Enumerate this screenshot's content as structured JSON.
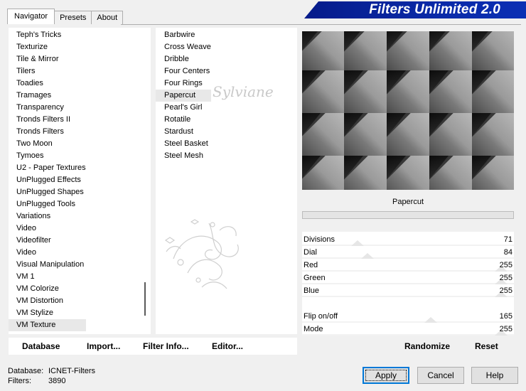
{
  "title": "Filters Unlimited 2.0",
  "tabs": [
    {
      "label": "Navigator",
      "active": true
    },
    {
      "label": "Presets",
      "active": false
    },
    {
      "label": "About",
      "active": false
    }
  ],
  "categories": [
    {
      "label": "Teph's Tricks"
    },
    {
      "label": "Texturize"
    },
    {
      "label": "Tile & Mirror"
    },
    {
      "label": "Tilers"
    },
    {
      "label": "Toadies"
    },
    {
      "label": "Tramages"
    },
    {
      "label": "Transparency"
    },
    {
      "label": "Tronds Filters II"
    },
    {
      "label": "Tronds Filters"
    },
    {
      "label": "Two Moon"
    },
    {
      "label": "Tymoes"
    },
    {
      "label": "U2 - Paper Textures"
    },
    {
      "label": "UnPlugged Effects"
    },
    {
      "label": "UnPlugged Shapes"
    },
    {
      "label": "UnPlugged Tools"
    },
    {
      "label": "Variations"
    },
    {
      "label": "Video"
    },
    {
      "label": "Videofilter"
    },
    {
      "label": "Video"
    },
    {
      "label": "Visual Manipulation"
    },
    {
      "label": "VM 1"
    },
    {
      "label": "VM Colorize"
    },
    {
      "label": "VM Distortion"
    },
    {
      "label": "VM Stylize"
    },
    {
      "label": "VM Texture",
      "selected": true
    }
  ],
  "filters": [
    {
      "label": "Barbwire"
    },
    {
      "label": "Cross Weave"
    },
    {
      "label": "Dribble"
    },
    {
      "label": "Four Centers"
    },
    {
      "label": "Four Rings"
    },
    {
      "label": "Papercut",
      "selected": true
    },
    {
      "label": "Pearl's Girl"
    },
    {
      "label": "Rotatile"
    },
    {
      "label": "Stardust"
    },
    {
      "label": "Steel Basket"
    },
    {
      "label": "Steel Mesh"
    }
  ],
  "watermark": "Sylviane",
  "preview": {
    "rows": 4,
    "cols": 5,
    "colors": {
      "dark": "#1a1a1a",
      "mid": "#7a7a7a",
      "light": "#b8b8b8"
    }
  },
  "current_filter": "Papercut",
  "progress": 0,
  "parameters": [
    {
      "label": "Divisions",
      "value": 71
    },
    {
      "label": "Dial",
      "value": 84
    },
    {
      "label": "Red",
      "value": 255
    },
    {
      "label": "Green",
      "value": 255
    },
    {
      "label": "Blue",
      "value": 255
    },
    {
      "label": "Flip on/off",
      "value": 165
    },
    {
      "label": "Mode",
      "value": 255
    }
  ],
  "toolbar": {
    "database": "Database",
    "import": "Import...",
    "filter_info": "Filter Info...",
    "editor": "Editor...",
    "randomize": "Randomize",
    "reset": "Reset"
  },
  "status": {
    "database_label": "Database:",
    "database_value": "ICNET-Filters",
    "filters_label": "Filters:",
    "filters_value": "3890"
  },
  "buttons": {
    "apply": "Apply",
    "cancel": "Cancel",
    "help": "Help"
  },
  "colors": {
    "banner": "#0a2aa8",
    "default_button_border": "#0078d7"
  }
}
